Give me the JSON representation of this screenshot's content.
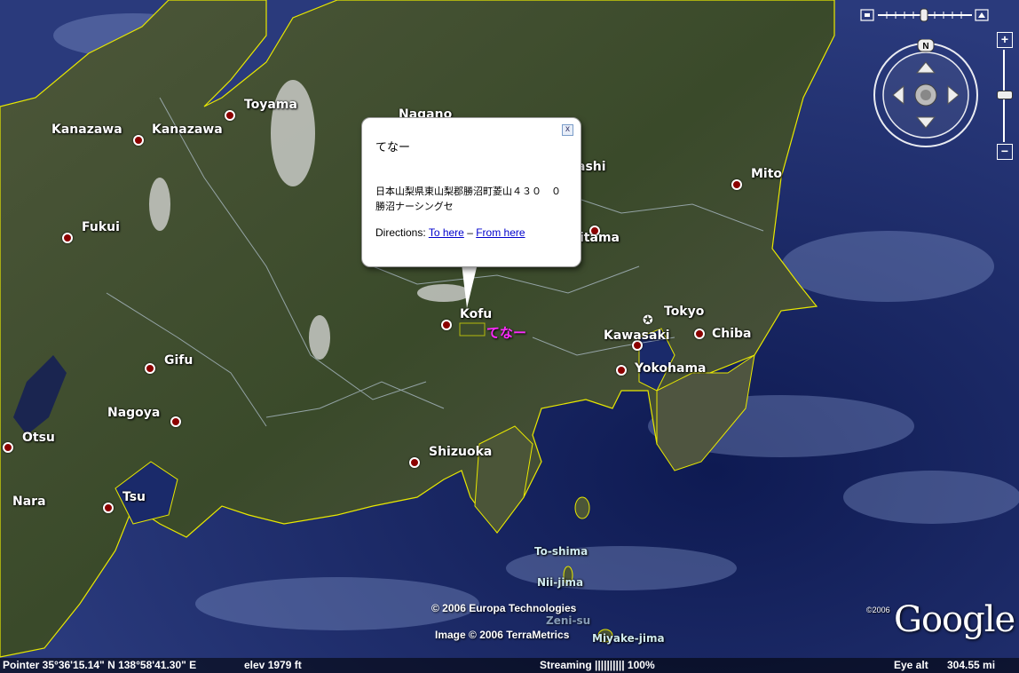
{
  "cities": [
    {
      "name": "Kanazawa"
    },
    {
      "name": "Kanazawa"
    },
    {
      "name": "Toyama"
    },
    {
      "name": "Nagano"
    },
    {
      "name": "Fukui"
    },
    {
      "name": "Gifu"
    },
    {
      "name": "Nagoya"
    },
    {
      "name": "Otsu"
    },
    {
      "name": "Tsu"
    },
    {
      "name": "Nara"
    },
    {
      "name": "Shizuoka"
    },
    {
      "name": "Kofu"
    },
    {
      "name": "Tokyo"
    },
    {
      "name": "Kawasaki"
    },
    {
      "name": "Yokohama"
    },
    {
      "name": "Chiba"
    },
    {
      "name": "Mito"
    },
    {
      "name": "ashi"
    },
    {
      "name": "itama"
    },
    {
      "name": "To-shima"
    },
    {
      "name": "Nii-jima"
    },
    {
      "name": "Miyake-jima"
    },
    {
      "name": "Zeni-su"
    }
  ],
  "placemark": {
    "label": "てなー"
  },
  "balloon": {
    "title": "てなー",
    "address": "日本山梨県東山梨郡勝沼町菱山４３０　０勝沼ナーシングセ",
    "directions_label": "Directions:",
    "to_here": "To here",
    "separator": "–",
    "from_here": "From here",
    "close": "x"
  },
  "nav": {
    "north": "N"
  },
  "zoom": {
    "plus": "+",
    "minus": "−"
  },
  "credits": {
    "europa": "© 2006 Europa Technologies",
    "terrametrics": "Image © 2006 TerraMetrics",
    "google_c": "©2006",
    "google": "Google"
  },
  "status": {
    "pointer": "Pointer  35°36'15.14\"  N    138°58'41.30\"  E",
    "elev": "elev   1979 ft",
    "streaming": "Streaming |||||||||| 100%",
    "eye_alt_label": "Eye alt",
    "eye_alt_value": "304.55 mi"
  },
  "colors": {
    "ocean": "#1a2a6a",
    "land": "#3e4a2c",
    "border": "#e8e800",
    "placemark": "#ff2aff"
  }
}
